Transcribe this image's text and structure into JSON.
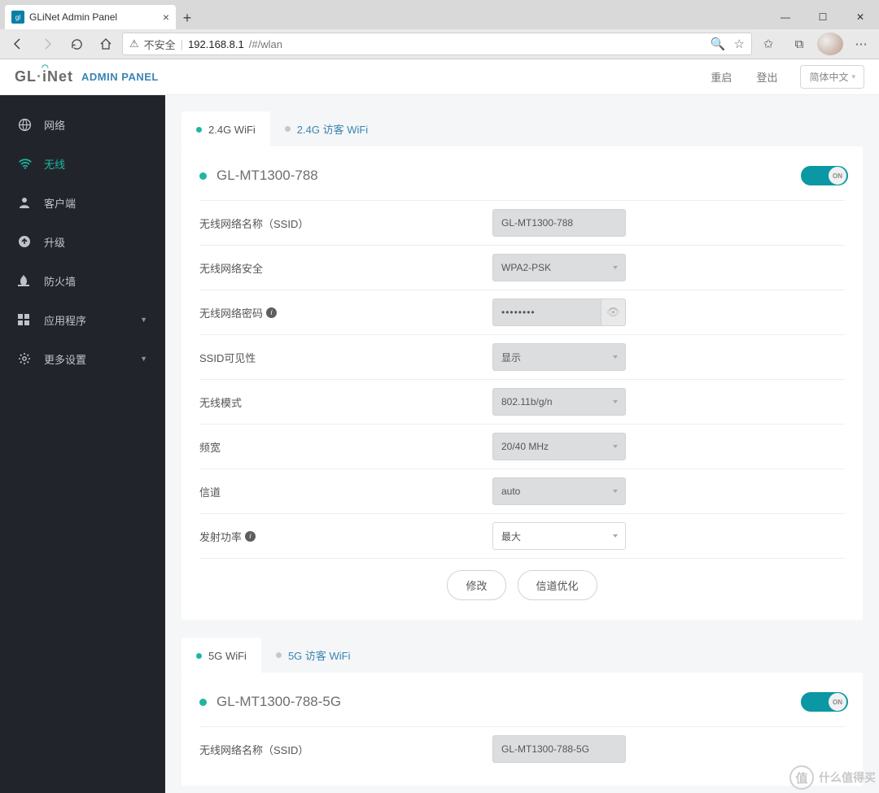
{
  "browser": {
    "tab_title": "GLiNet Admin Panel",
    "insecure_label": "不安全",
    "url_host": "192.168.8.1",
    "url_path": "/#/wlan"
  },
  "header": {
    "brand_left": "GL",
    "brand_right": "iNet",
    "subtitle": "ADMIN PANEL",
    "reboot": "重启",
    "logout": "登出",
    "lang": "简体中文"
  },
  "sidebar": {
    "items": [
      {
        "icon": "globe",
        "label": "网络",
        "sub": false
      },
      {
        "icon": "wifi",
        "label": "无线",
        "sub": false,
        "active": true
      },
      {
        "icon": "person",
        "label": "客户端",
        "sub": false
      },
      {
        "icon": "up",
        "label": "升级",
        "sub": false
      },
      {
        "icon": "fire",
        "label": "防火墙",
        "sub": false
      },
      {
        "icon": "grid",
        "label": "应用程序",
        "sub": true
      },
      {
        "icon": "gear",
        "label": "更多设置",
        "sub": true
      }
    ]
  },
  "tabs24": {
    "main": "2.4G WiFi",
    "guest": "2.4G 访客 WiFi"
  },
  "tabs5": {
    "main": "5G WiFi",
    "guest": "5G 访客 WiFi"
  },
  "panel24": {
    "title": "GL-MT1300-788",
    "toggle_on": "ON",
    "fields": {
      "ssid_label": "无线网络名称（SSID）",
      "ssid_value": "GL-MT1300-788",
      "security_label": "无线网络安全",
      "security_value": "WPA2-PSK",
      "password_label": "无线网络密码",
      "password_value": "••••••••",
      "visibility_label": "SSID可见性",
      "visibility_value": "显示",
      "mode_label": "无线模式",
      "mode_value": "802.11b/g/n",
      "bandwidth_label": "频宽",
      "bandwidth_value": "20/40 MHz",
      "channel_label": "信道",
      "channel_value": "auto",
      "txpower_label": "发射功率",
      "txpower_value": "最大"
    },
    "btn_modify": "修改",
    "btn_channel_opt": "信道优化"
  },
  "panel5": {
    "title": "GL-MT1300-788-5G",
    "toggle_on": "ON",
    "ssid_label": "无线网络名称（SSID）",
    "ssid_value": "GL-MT1300-788-5G"
  },
  "watermark": {
    "char": "值",
    "text": "什么值得买"
  }
}
